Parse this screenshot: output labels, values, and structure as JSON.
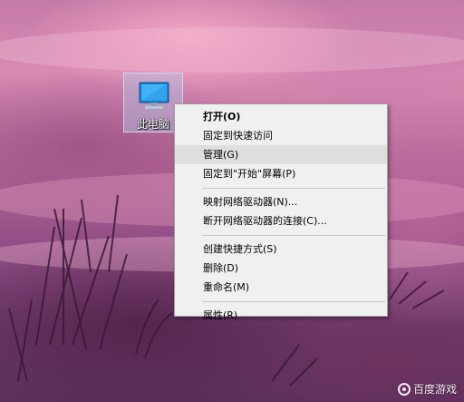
{
  "desktop": {
    "icon": {
      "label": "此电脑",
      "icon": "computer-monitor-icon"
    }
  },
  "context_menu": {
    "items": [
      {
        "label": "打开(O)",
        "bold": true
      },
      {
        "label": "固定到快速访问"
      },
      {
        "label": "管理(G)",
        "highlighted": true
      },
      {
        "label": "固定到\"开始\"屏幕(P)"
      },
      {
        "separator": true
      },
      {
        "label": "映射网络驱动器(N)..."
      },
      {
        "label": "断开网络驱动器的连接(C)..."
      },
      {
        "separator": true
      },
      {
        "label": "创建快捷方式(S)"
      },
      {
        "label": "删除(D)"
      },
      {
        "label": "重命名(M)"
      },
      {
        "separator": true
      },
      {
        "label": "属性(R)"
      }
    ]
  },
  "watermark": {
    "text": "百度游戏"
  },
  "colors": {
    "menu_background": "#f0f0f0",
    "menu_highlight": "#dedede",
    "icon_selection": "#b4c8e6"
  }
}
